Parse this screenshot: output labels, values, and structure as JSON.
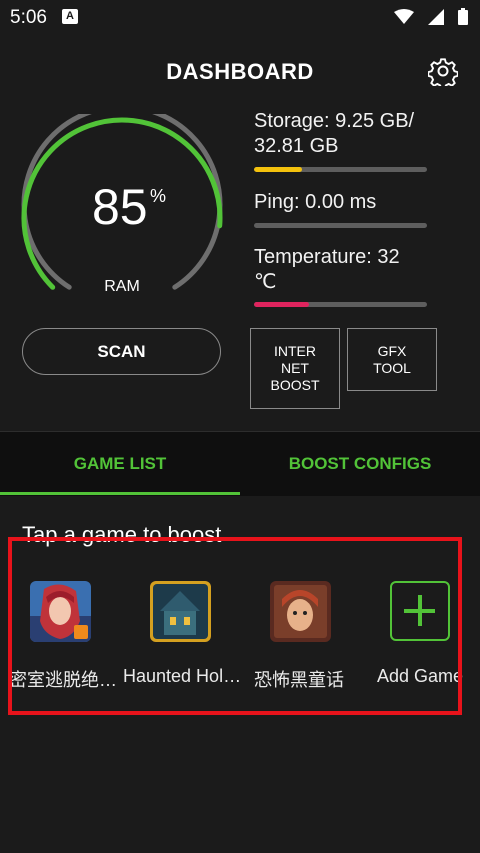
{
  "status_bar": {
    "time": "5:06",
    "notification_icon": "A"
  },
  "header": {
    "title": "DASHBOARD"
  },
  "ram": {
    "value": "85",
    "unit": "%",
    "label": "RAM",
    "fraction": 0.85
  },
  "stats": {
    "storage": {
      "text": "Storage: 9.25 GB/ 32.81 GB",
      "line1": "Storage: 9.25 GB/",
      "line2": "32.81 GB",
      "fill": 0.28,
      "color": "#f4c20d"
    },
    "ping": {
      "text": "Ping: 0.00 ms",
      "fill": 0.0
    },
    "temperature": {
      "line1": "Temperature: 32",
      "line2": "℃",
      "fill": 0.32,
      "color": "#e0245e"
    }
  },
  "buttons": {
    "scan": "SCAN",
    "internet_boost": "INTER\nNET\nBOOST",
    "gfx_tool": "GFX\nTOOL"
  },
  "tabs": [
    {
      "label": "GAME LIST",
      "active": true
    },
    {
      "label": "BOOST CONFIGS",
      "active": false
    }
  ],
  "hint": "Tap a game to boost",
  "games": [
    {
      "name": "密室逃脱绝…",
      "icon": "escape-game-icon"
    },
    {
      "name": "Haunted Hol…",
      "icon": "haunted-house-icon"
    },
    {
      "name": "恐怖黑童话",
      "icon": "horror-fairytale-icon"
    }
  ],
  "add_game": {
    "label": "Add Game",
    "icon": "plus-icon"
  },
  "colors": {
    "accent": "#52c338",
    "highlight": "#e8131b",
    "background": "#1b1b1b"
  }
}
